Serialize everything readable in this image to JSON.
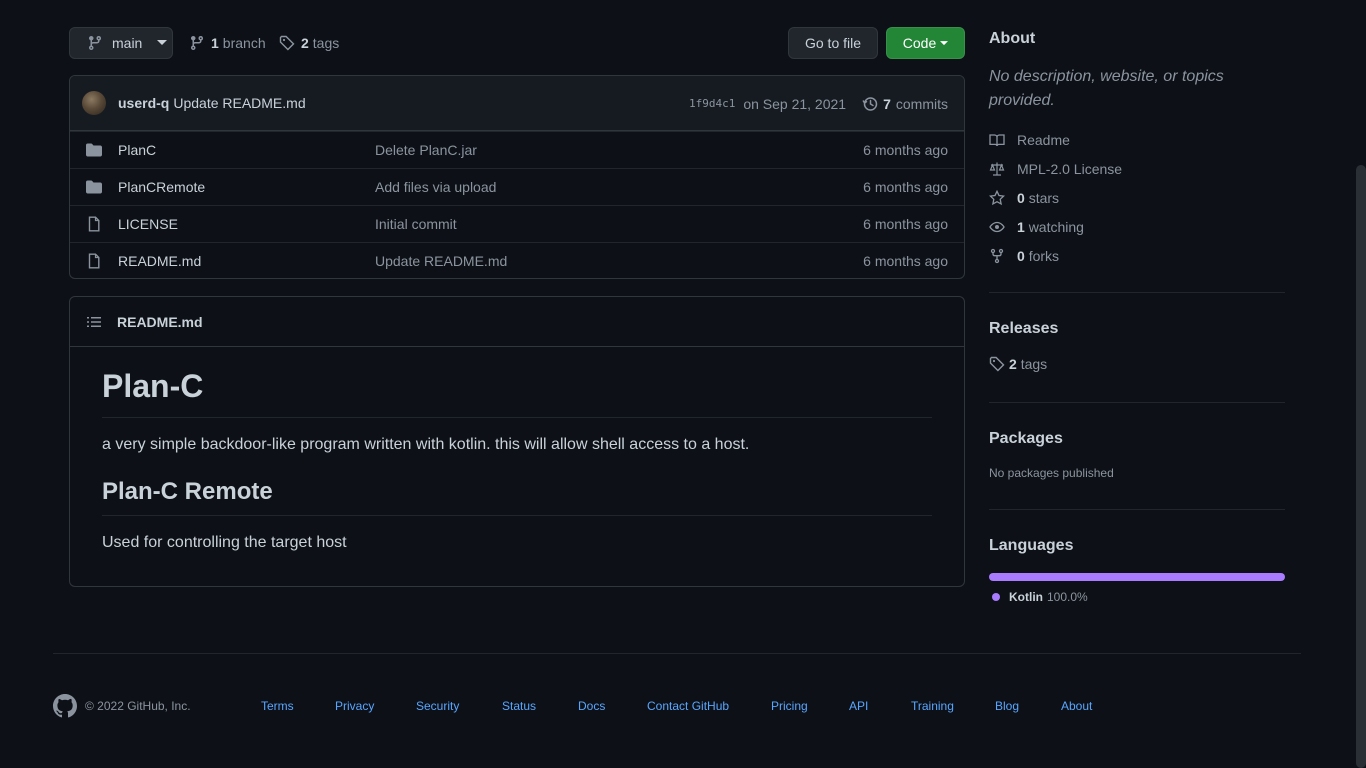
{
  "toolbar": {
    "branch_label": "main",
    "branch_count": "1",
    "branch_word": "branch",
    "tag_count": "2",
    "tag_word": "tags",
    "goto_label": "Go to file",
    "code_label": "Code"
  },
  "commit": {
    "author": "userd-q",
    "message": "Update README.md",
    "sha": "1f9d4c1",
    "date": "on Sep 21, 2021",
    "count": "7",
    "count_word": "commits"
  },
  "files": [
    {
      "type": "folder",
      "name": "PlanC",
      "message": "Delete PlanC.jar",
      "age": "6 months ago"
    },
    {
      "type": "folder",
      "name": "PlanCRemote",
      "message": "Add files via upload",
      "age": "6 months ago"
    },
    {
      "type": "file",
      "name": "LICENSE",
      "message": "Initial commit",
      "age": "6 months ago"
    },
    {
      "type": "file",
      "name": "README.md",
      "message": "Update README.md",
      "age": "6 months ago"
    }
  ],
  "readme": {
    "filename": "README.md",
    "h1": "Plan-C",
    "p1": "a very simple backdoor-like program written with kotlin. this will allow shell access to a host.",
    "h2": "Plan-C Remote",
    "p2": "Used for controlling the target host"
  },
  "about": {
    "title": "About",
    "description": "No description, website, or topics provided.",
    "readme": "Readme",
    "license": "MPL-2.0 License",
    "stars_count": "0",
    "stars_word": "stars",
    "watching_count": "1",
    "watching_word": "watching",
    "forks_count": "0",
    "forks_word": "forks"
  },
  "releases": {
    "title": "Releases",
    "tag_count": "2",
    "tag_word": "tags"
  },
  "packages": {
    "title": "Packages",
    "text": "No packages published"
  },
  "languages": {
    "title": "Languages",
    "items": [
      {
        "name": "Kotlin",
        "percent": "100.0%",
        "share": 1.0,
        "color": "#a97bff"
      }
    ]
  },
  "footer": {
    "copyright": "© 2022 GitHub, Inc.",
    "links": [
      "Terms",
      "Privacy",
      "Security",
      "Status",
      "Docs",
      "Contact GitHub",
      "Pricing",
      "API",
      "Training",
      "Blog",
      "About"
    ]
  },
  "colors": {
    "background": "#0d1117",
    "accent_link": "#58a6ff",
    "code_button": "#238636",
    "kotlin": "#a97bff"
  }
}
